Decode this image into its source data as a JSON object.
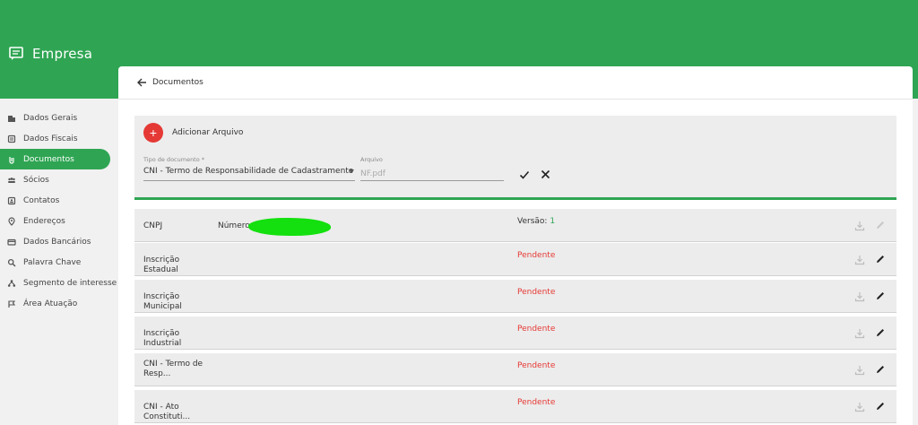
{
  "app": {
    "title": "Empresa"
  },
  "sidebar": {
    "items": [
      {
        "label": "Dados Gerais",
        "icon": "building-icon",
        "active": false
      },
      {
        "label": "Dados Fiscais",
        "icon": "receipt-icon",
        "active": false
      },
      {
        "label": "Documentos",
        "icon": "attachment-icon",
        "active": true
      },
      {
        "label": "Sócios",
        "icon": "people-icon",
        "active": false
      },
      {
        "label": "Contatos",
        "icon": "contacts-icon",
        "active": false
      },
      {
        "label": "Endereços",
        "icon": "location-pin-icon",
        "active": false
      },
      {
        "label": "Dados Bancários",
        "icon": "credit-card-icon",
        "active": false
      },
      {
        "label": "Palavra Chave",
        "icon": "search-icon",
        "active": false
      },
      {
        "label": "Segmento de interesse",
        "icon": "hierarchy-icon",
        "active": false
      },
      {
        "label": "Área Atuação",
        "icon": "flag-icon",
        "active": false
      }
    ]
  },
  "header": {
    "title": "Documentos"
  },
  "upload": {
    "add_label": "Adicionar Arquivo",
    "add_symbol": "+",
    "type_label": "Tipo de documento *",
    "type_value": "CNI - Termo de Responsabilidade de Cadastramento",
    "file_label": "Arquivo",
    "file_placeholder": "NF.pdf"
  },
  "documents": [
    {
      "name": "CNPJ",
      "number_label": "Número:",
      "version_label": "Versão:",
      "version_value": "1",
      "status": "",
      "editable": false
    },
    {
      "name": "Inscrição Estadual",
      "status": "Pendente",
      "editable": true
    },
    {
      "name": "Inscrição Municipal",
      "status": "Pendente",
      "editable": true
    },
    {
      "name": "Inscrição Industrial",
      "status": "Pendente",
      "editable": true
    },
    {
      "name": "CNI - Termo de Resp...",
      "status": "Pendente",
      "editable": true
    },
    {
      "name": "CNI - Ato Constituti...",
      "status": "Pendente",
      "editable": true
    }
  ],
  "colors": {
    "primary": "#2fa553",
    "danger": "#e53935",
    "redaction": "#13e00e"
  }
}
